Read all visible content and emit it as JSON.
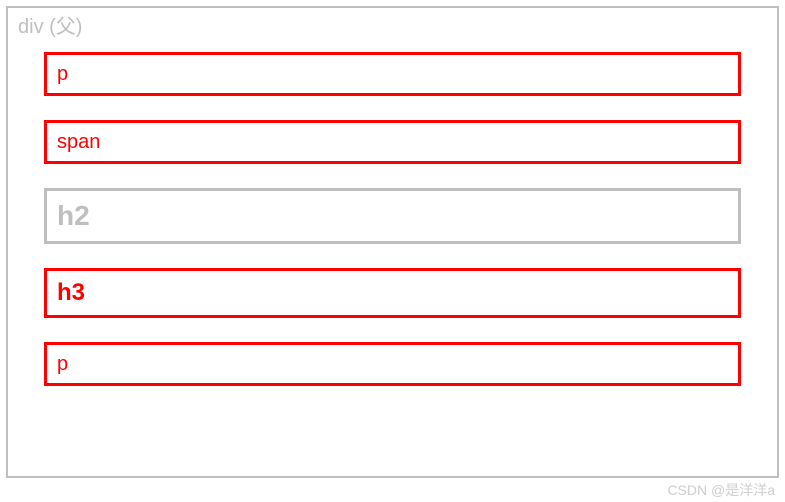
{
  "parent": {
    "label": "div (父)"
  },
  "children": [
    {
      "label": "p",
      "variant": "red",
      "size": "normal"
    },
    {
      "label": "span",
      "variant": "red",
      "size": "normal"
    },
    {
      "label": "h2",
      "variant": "gray",
      "size": "h2"
    },
    {
      "label": "h3",
      "variant": "red",
      "size": "h3"
    },
    {
      "label": "p",
      "variant": "red",
      "size": "normal"
    }
  ],
  "watermark": "CSDN @是洋洋a"
}
